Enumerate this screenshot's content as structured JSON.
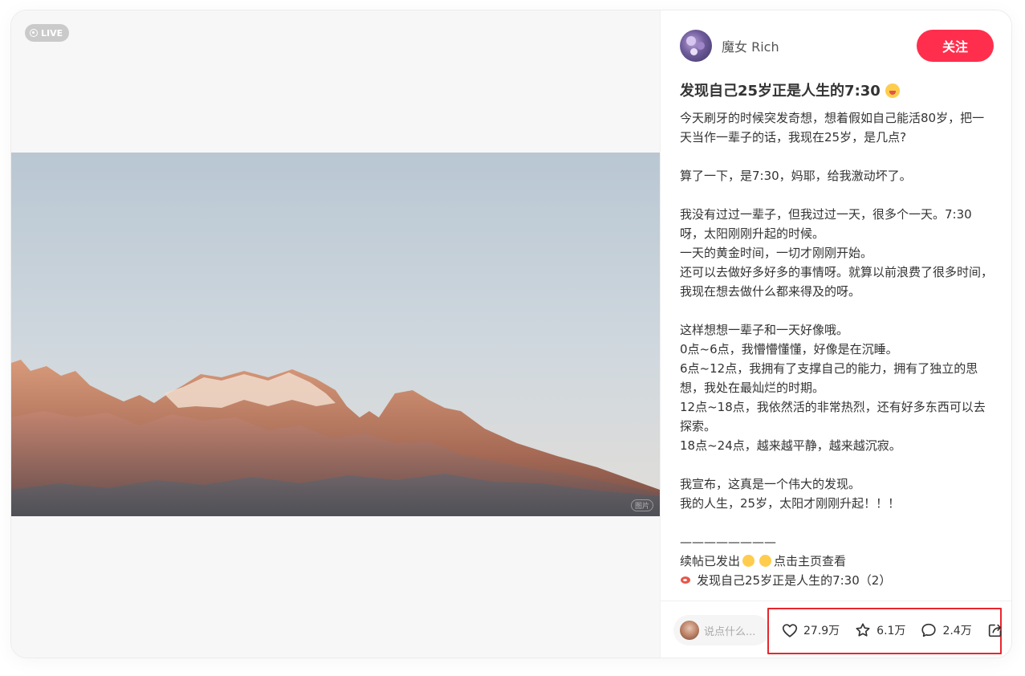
{
  "media": {
    "live_label": "LIVE",
    "watermark": "图片"
  },
  "author": {
    "name": "魔女 Rich",
    "follow_label": "关注"
  },
  "note": {
    "title": "发现自己25岁正是人生的7:30",
    "body": "今天刷牙的时候突发奇想，想着假如自己能活80岁，把一天当作一辈子的话，我现在25岁，是几点?\n\n算了一下，是7:30，妈耶，给我激动坏了。\n\n我没有过过一辈子，但我过过一天，很多个一天。7:30呀，太阳刚刚升起的时候。\n一天的黄金时间，一切才刚刚开始。\n还可以去做好多好多的事情呀。就算以前浪费了很多时间，我现在想去做什么都来得及的呀。\n\n这样想想一辈子和一天好像哦。\n0点~6点，我懵懵懂懂，好像是在沉睡。\n6点~12点，我拥有了支撑自己的能力，拥有了独立的思想，我处在最灿烂的时期。\n12点~18点，我依然活的非常热烈，还有好多东西可以去探索。\n18点~24点，越来越平静，越来越沉寂。\n\n我宣布，这真是一个伟大的发现。\n我的人生，25岁，太阳才刚刚升起！！！\n\n————————",
    "followup_line1_prefix": "续帖已发出",
    "followup_line1_suffix": "点击主页查看",
    "followup_line2": "发现自己25岁正是人生的7:30（2）"
  },
  "comment": {
    "placeholder": "说点什么..."
  },
  "stats": {
    "likes": "27.9万",
    "collects": "6.1万",
    "comments": "2.4万"
  },
  "colors": {
    "accent": "#ff2e4d",
    "highlight": "#e8262d"
  }
}
